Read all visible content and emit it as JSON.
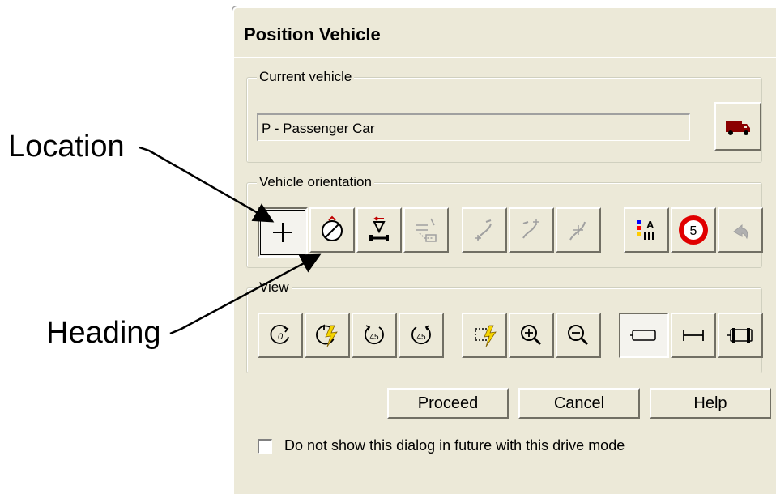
{
  "callouts": {
    "location": "Location",
    "heading": "Heading"
  },
  "dialog": {
    "title": "Position Vehicle",
    "current_vehicle": {
      "legend": "Current vehicle",
      "value": "P - Passenger Car",
      "vehicle_button_icon": "truck-icon"
    },
    "orientation": {
      "legend": "Vehicle orientation",
      "buttons": [
        {
          "icon": "location-crosshair-icon",
          "state": "pressed"
        },
        {
          "icon": "heading-dial-icon",
          "state": "enabled"
        },
        {
          "icon": "vehicle-flip-icon",
          "state": "enabled"
        },
        {
          "icon": "vehicle-path-icon",
          "state": "disabled"
        },
        {
          "icon": "curve-left-icon",
          "state": "disabled"
        },
        {
          "icon": "curve-right-icon",
          "state": "disabled"
        },
        {
          "icon": "curve-snap-icon",
          "state": "disabled"
        },
        {
          "icon": "color-text-icon",
          "state": "enabled"
        },
        {
          "icon": "speed-limit-icon",
          "label": "5",
          "state": "enabled"
        },
        {
          "icon": "undo-icon",
          "state": "disabled"
        }
      ]
    },
    "view": {
      "legend": "View",
      "buttons": [
        {
          "icon": "rotate-zero-icon",
          "label": "0"
        },
        {
          "icon": "rotate-auto-icon"
        },
        {
          "icon": "rotate-ccw-45-icon",
          "label": "45"
        },
        {
          "icon": "rotate-cw-45-icon",
          "label": "45"
        },
        {
          "icon": "zoom-extents-icon"
        },
        {
          "icon": "zoom-in-icon"
        },
        {
          "icon": "zoom-out-icon"
        },
        {
          "icon": "vehicle-outline-icon",
          "state": "pressed"
        },
        {
          "icon": "vehicle-length-icon"
        },
        {
          "icon": "vehicle-detail-icon"
        }
      ]
    },
    "actions": {
      "proceed": "Proceed",
      "cancel": "Cancel",
      "help": "Help"
    },
    "checkbox": {
      "label": "Do not show this dialog in future with this drive mode",
      "checked": false
    }
  },
  "colors": {
    "dialog_bg": "#ece9d8",
    "truck": "#8b0000",
    "speed_ring": "#e00000",
    "lightning": "#f5d400"
  }
}
